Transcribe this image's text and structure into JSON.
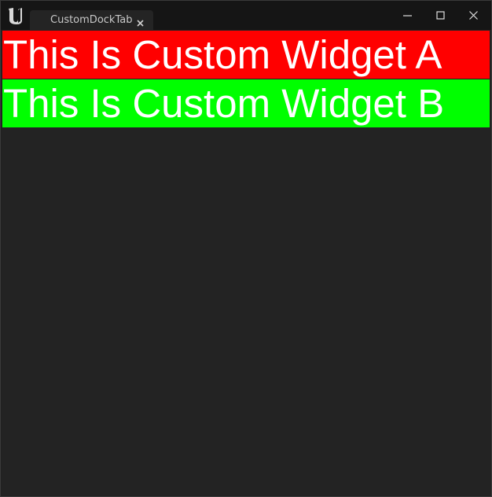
{
  "window": {
    "app_icon": "unreal-engine-logo-icon",
    "controls": {
      "minimize_icon": "minimize-icon",
      "maximize_icon": "maximize-icon",
      "close_icon": "close-icon"
    }
  },
  "tab": {
    "label": "CustomDockTab",
    "close_icon": "close-icon"
  },
  "widgets": [
    {
      "text": "This Is Custom Widget A",
      "background": "#ff0000",
      "color": "#ffffff"
    },
    {
      "text": "This Is Custom Widget B",
      "background": "#00ff00",
      "color": "#ffffff"
    }
  ],
  "colors": {
    "titlebar": "#151515",
    "tab": "#242424",
    "content_background": "#232323"
  }
}
